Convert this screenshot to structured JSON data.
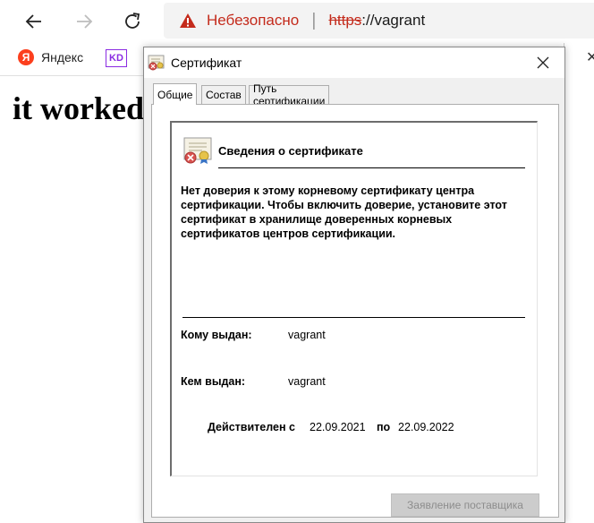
{
  "browser": {
    "address": {
      "security_label": "Небезопасно",
      "separator": "|",
      "url_scheme": "https",
      "url_rest": "://vagrant"
    },
    "favorites": [
      {
        "label": "Яндекс",
        "icon": "yandex-logo"
      },
      {
        "label": "",
        "icon": "kd-logo"
      }
    ]
  },
  "page": {
    "text": "it worked"
  },
  "dialog": {
    "title": "Сертификат",
    "tabs": [
      "Общие",
      "Состав",
      "Путь сертификации"
    ],
    "active_tab": "Общие",
    "info_heading": "Сведения о сертификате",
    "warning_text": "Нет доверия к этому корневому сертификату центра сертификации. Чтобы включить  доверие, установите этот сертификат в хранилище доверенных корневых сертификатов центров сертификации.",
    "issued_to_label": "Кому выдан:",
    "issued_to_value": "vagrant",
    "issued_by_label": "Кем выдан:",
    "issued_by_value": "vagrant",
    "valid_from_label": "Действителен с",
    "valid_from_value": "22.09.2021",
    "valid_to_label": "по",
    "valid_to_value": "22.09.2022",
    "issuer_statement_button": "Заявление поставщика"
  },
  "colors": {
    "insecure_red": "#c42b1c",
    "dialog_bg": "#f0f0f0",
    "yandex_red": "#fc3f1d"
  }
}
